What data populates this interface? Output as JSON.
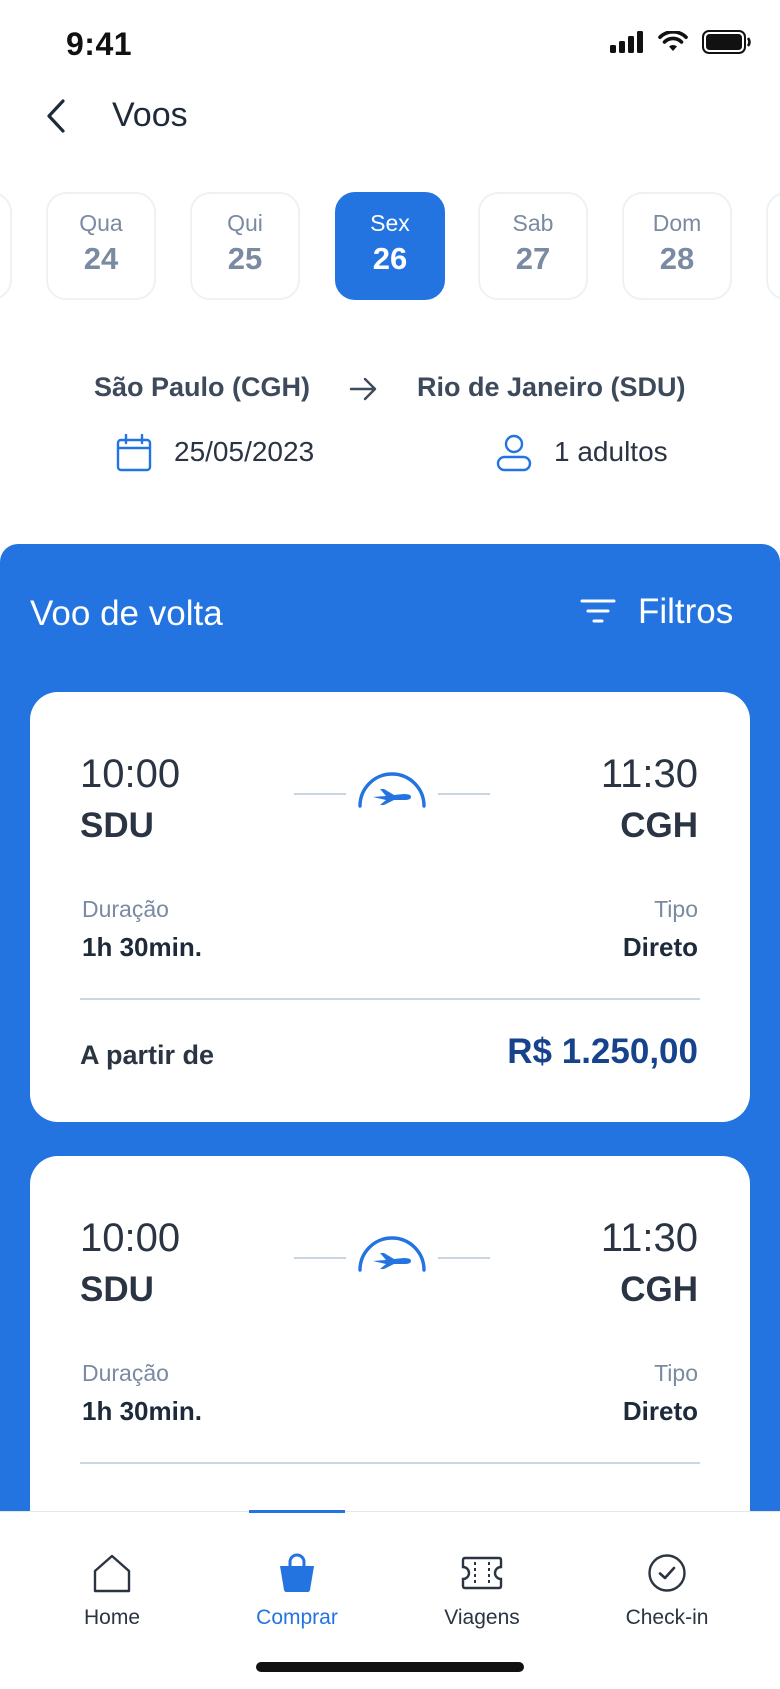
{
  "status_bar": {
    "time": "9:41"
  },
  "header": {
    "title": "Voos"
  },
  "dates": [
    {
      "dow": "",
      "day": ""
    },
    {
      "dow": "Qua",
      "day": "24"
    },
    {
      "dow": "Qui",
      "day": "25"
    },
    {
      "dow": "Sex",
      "day": "26",
      "selected": true
    },
    {
      "dow": "Sab",
      "day": "27"
    },
    {
      "dow": "Dom",
      "day": "28"
    },
    {
      "dow": "",
      "day": ""
    }
  ],
  "route": {
    "origin": "São Paulo (CGH)",
    "destination": "Rio de Janeiro (SDU)",
    "date": "25/05/2023",
    "passengers": "1 adultos"
  },
  "results": {
    "title": "Voo de volta",
    "filter_label": "Filtros"
  },
  "flights": [
    {
      "dep_time": "10:00",
      "dep_code": "SDU",
      "arr_time": "11:30",
      "arr_code": "CGH",
      "duration_label": "Duração",
      "duration": "1h 30min.",
      "type_label": "Tipo",
      "type": "Direto",
      "from_label": "A partir de",
      "price": "R$ 1.250,00"
    },
    {
      "dep_time": "10:00",
      "dep_code": "SDU",
      "arr_time": "11:30",
      "arr_code": "CGH",
      "duration_label": "Duração",
      "duration": "1h 30min.",
      "type_label": "Tipo",
      "type": "Direto",
      "from_label": "",
      "price": ""
    }
  ],
  "bottom_nav": [
    {
      "label": "Home",
      "icon": "home-icon"
    },
    {
      "label": "Comprar",
      "icon": "shopping-bag-icon",
      "active": true
    },
    {
      "label": "Viagens",
      "icon": "ticket-icon"
    },
    {
      "label": "Check-in",
      "icon": "check-circle-icon"
    }
  ],
  "colors": {
    "primary": "#2374e1",
    "price": "#16438c",
    "muted": "#7a8aa0"
  }
}
